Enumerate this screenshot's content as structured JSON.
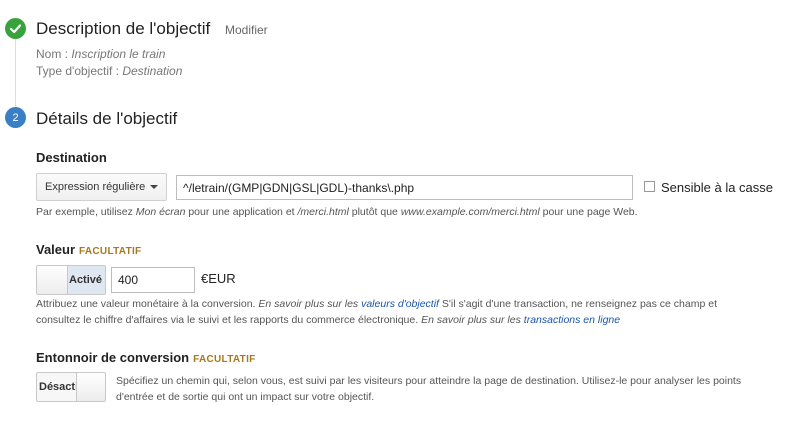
{
  "steps": [
    {
      "title": "Description de l'objectif",
      "action": "Modifier",
      "meta": [
        {
          "label": "Nom : ",
          "value": "Inscription le train"
        },
        {
          "label": "Type d'objectif : ",
          "value": "Destination"
        }
      ]
    },
    {
      "number": "2",
      "title": "Détails de l'objectif"
    }
  ],
  "destination": {
    "label": "Destination",
    "match_type": "Expression régulière",
    "value": "^/letrain/(GMP|GDN|GSL|GDL)-thanks\\.php",
    "case_sensitive_label": "Sensible à la casse",
    "help": {
      "p1": "Par exemple, utilisez ",
      "em1": "Mon écran",
      "p2": " pour une application et ",
      "em2": "/merci.html",
      "p3": " plutôt que ",
      "em3": "www.example.com/merci.html",
      "p4": " pour une page Web."
    }
  },
  "value": {
    "label": "Valeur",
    "optional": "FACULTATIF",
    "toggle_label": "Activé",
    "amount": "400",
    "currency": "€EUR",
    "help": {
      "p1": "Attribuez une valeur monétaire à la conversion. ",
      "em1": "En savoir plus sur les ",
      "link1": "valeurs d'objectif",
      "p2": " S'il s'agit d'une transaction, ne renseignez pas ce champ et",
      "p3": "consultez le chiffre d'affaires via le suivi et les rapports du commerce électronique. ",
      "em2": "En savoir plus sur les ",
      "link2": "transactions en ligne"
    }
  },
  "funnel": {
    "label": "Entonnoir de conversion",
    "optional": "FACULTATIF",
    "toggle_label": "Désacti",
    "help_line1": "Spécifiez un chemin qui, selon vous, est suivi par les visiteurs pour atteindre la page de destination. Utilisez-le pour analyser les points",
    "help_line2": "d'entrée et de sortie qui ont un impact sur votre objectif."
  }
}
